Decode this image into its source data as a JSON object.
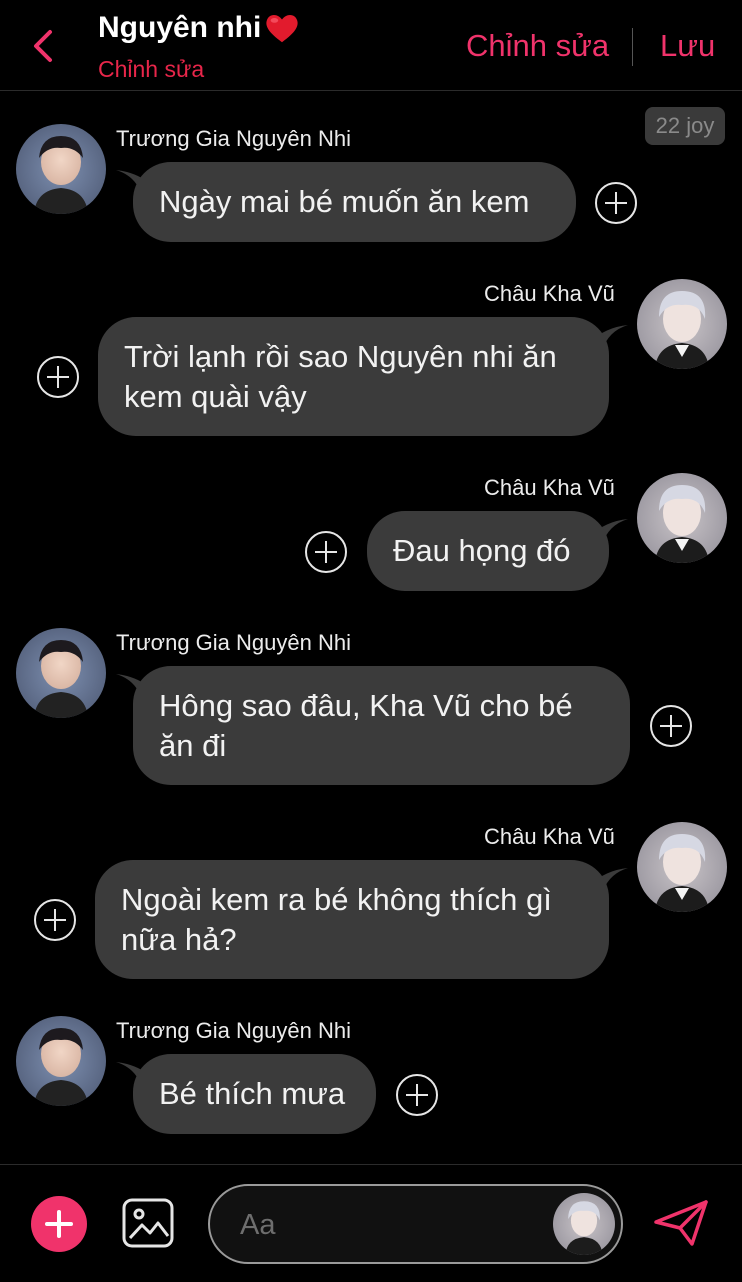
{
  "header": {
    "title": "Nguyên nhi",
    "subtitle": "Chỉnh sửa",
    "edit_label": "Chỉnh sửa",
    "save_label": "Lưu"
  },
  "time_badge": "22 joy",
  "messages": [
    {
      "side": "left",
      "sender": "Trương Gia Nguyên Nhi",
      "lines": [
        "Ngày mai bé muốn ăn kem"
      ]
    },
    {
      "side": "right",
      "sender": "Châu Kha Vũ",
      "lines": [
        "Trời lạnh rồi sao Nguyên nhi ăn",
        "kem quài vậy"
      ]
    },
    {
      "side": "right",
      "sender": "Châu Kha Vũ",
      "lines": [
        "Đau họng đó"
      ]
    },
    {
      "side": "left",
      "sender": "Trương Gia Nguyên Nhi",
      "lines": [
        "Hông sao đâu, Kha Vũ cho bé",
        "ăn đi"
      ]
    },
    {
      "side": "right",
      "sender": "Châu Kha Vũ",
      "lines": [
        "Ngoài kem ra bé không thích gì",
        "nữa hả?"
      ]
    },
    {
      "side": "left",
      "sender": "Trương Gia Nguyên Nhi",
      "lines": [
        "Bé thích mưa"
      ]
    }
  ],
  "composer": {
    "placeholder": "Aa"
  },
  "colors": {
    "accent": "#f0336b",
    "subtitle": "#e8264a",
    "bubble": "#3b3b3b",
    "background": "#000000"
  },
  "icons": {
    "back": "chevron-left-icon",
    "heart": "heart-icon",
    "add": "plus-icon",
    "image": "image-icon",
    "send": "send-icon",
    "reaction": "add-reaction-icon"
  }
}
